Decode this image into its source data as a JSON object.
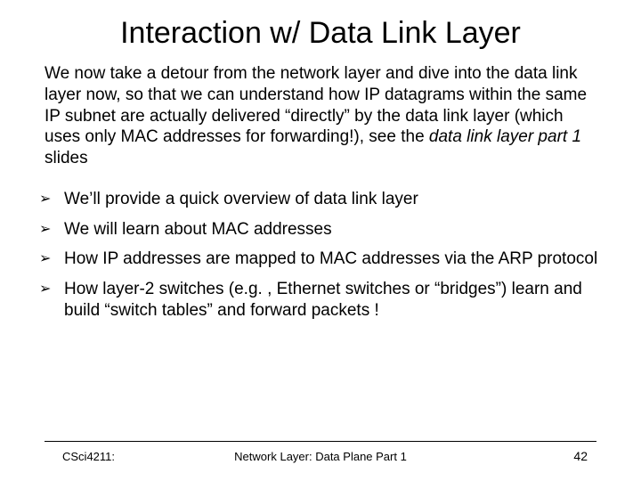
{
  "title": "Interaction w/ Data Link Layer",
  "intro_part1": "We now take a detour from the network layer and dive into the data link layer now, so that we can understand how IP datagrams within the same IP subnet are actually delivered “directly” by the data link layer (which uses only MAC addresses for forwarding!), see the ",
  "intro_italic": "data link layer part 1",
  "intro_part2": " slides",
  "bullets": [
    "We’ll provide a quick overview of data link layer",
    " We will learn about MAC addresses",
    " How IP addresses are mapped to MAC addresses via the ARP protocol",
    "How layer-2 switches (e.g. , Ethernet switches or “bridges”) learn and build “switch tables” and forward packets !"
  ],
  "arrow": "➢",
  "footer": {
    "left": "CSci4211:",
    "center": "Network Layer: Data Plane Part 1",
    "right": "42"
  }
}
